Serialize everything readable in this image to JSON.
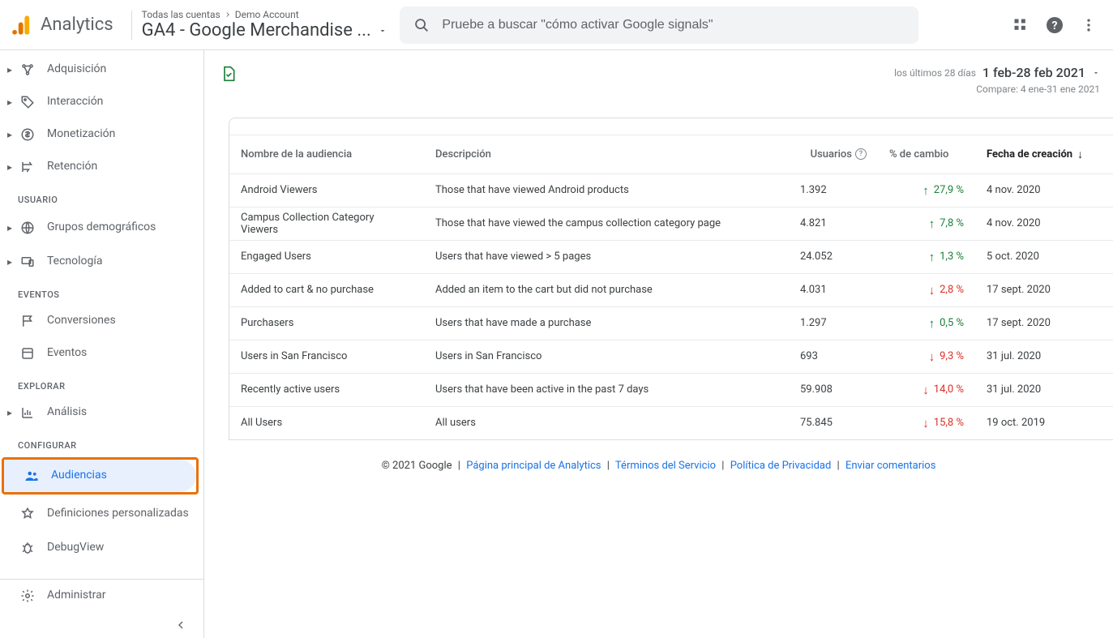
{
  "header": {
    "logo_text": "Analytics",
    "breadcrumb_parent": "Todas las cuentas",
    "breadcrumb_child": "Demo Account",
    "property_name": "GA4 - Google Merchandise ...",
    "search_placeholder": "Pruebe a buscar \"cómo activar Google signals\""
  },
  "date": {
    "relative": "los últimos 28 días",
    "range": "1 feb-28 feb 2021",
    "compare": "Compare: 4 ene-31 ene 2021"
  },
  "sidebar": {
    "adquisicion": "Adquisición",
    "interaccion": "Interacción",
    "monetizacion": "Monetización",
    "retencion": "Retención",
    "section_usuario": "Usuario",
    "demograficos": "Grupos demográficos",
    "tecnologia": "Tecnología",
    "section_eventos": "Eventos",
    "conversiones": "Conversiones",
    "eventos": "Eventos",
    "section_explorar": "Explorar",
    "analisis": "Análisis",
    "section_configurar": "Configurar",
    "audiencias": "Audiencias",
    "defs_personalizadas": "Definiciones personalizadas",
    "debugview": "DebugView",
    "administrar": "Administrar"
  },
  "table": {
    "headers": {
      "name": "Nombre de la audiencia",
      "desc": "Descripción",
      "users": "Usuarios",
      "change": "% de cambio",
      "created": "Fecha de creación"
    },
    "rows": [
      {
        "name": "Android Viewers",
        "desc": "Those that have viewed Android products",
        "users": "1.392",
        "change": "27,9 %",
        "dir": "up",
        "created": "4 nov. 2020"
      },
      {
        "name": "Campus Collection Category Viewers",
        "desc": "Those that have viewed the campus collection category page",
        "users": "4.821",
        "change": "7,8 %",
        "dir": "up",
        "created": "4 nov. 2020"
      },
      {
        "name": "Engaged Users",
        "desc": "Users that have viewed > 5 pages",
        "users": "24.052",
        "change": "1,3 %",
        "dir": "up",
        "created": "5 oct. 2020"
      },
      {
        "name": "Added to cart & no purchase",
        "desc": "Added an item to the cart but did not purchase",
        "users": "4.031",
        "change": "2,8 %",
        "dir": "down",
        "created": "17 sept. 2020"
      },
      {
        "name": "Purchasers",
        "desc": "Users that have made a purchase",
        "users": "1.297",
        "change": "0,5 %",
        "dir": "up",
        "created": "17 sept. 2020"
      },
      {
        "name": "Users in San Francisco",
        "desc": "Users in San Francisco",
        "users": "693",
        "change": "9,3 %",
        "dir": "down",
        "created": "31 jul. 2020"
      },
      {
        "name": "Recently active users",
        "desc": "Users that have been active in the past 7 days",
        "users": "59.908",
        "change": "14,0 %",
        "dir": "down",
        "created": "31 jul. 2020"
      },
      {
        "name": "All Users",
        "desc": "All users",
        "users": "75.845",
        "change": "15,8 %",
        "dir": "down",
        "created": "19 oct. 2019"
      }
    ]
  },
  "footer": {
    "copyright": "© 2021 Google",
    "home": "Página principal de Analytics",
    "terms": "Términos del Servicio",
    "privacy": "Política de Privacidad",
    "feedback": "Enviar comentarios"
  }
}
